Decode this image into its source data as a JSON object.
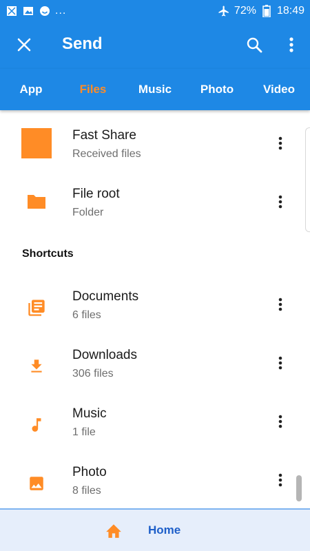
{
  "status_bar": {
    "battery_percent": "72%",
    "time": "18:49",
    "more_notifications": "...",
    "icons": [
      "gallery-notification-icon",
      "image-icon",
      "smiley-icon",
      "airplane-mode-icon",
      "battery-icon"
    ]
  },
  "app_bar": {
    "title": "Send",
    "icons": [
      "close-icon",
      "search-icon",
      "more-vert-icon"
    ],
    "background": "#1e88e5"
  },
  "tabs": [
    {
      "label": "App",
      "active": false
    },
    {
      "label": "Files",
      "active": true
    },
    {
      "label": "Music",
      "active": false
    },
    {
      "label": "Photo",
      "active": false
    },
    {
      "label": "Video",
      "active": false
    }
  ],
  "accent_color": "#ff8c26",
  "items": [
    {
      "title": "Fast Share",
      "subtitle": "Received files",
      "icon": "fast-share-square-icon"
    },
    {
      "title": "File root",
      "subtitle": "Folder",
      "icon": "folder-icon"
    }
  ],
  "shortcuts_header": "Shortcuts",
  "shortcuts": [
    {
      "title": "Documents",
      "subtitle": "6 files",
      "icon": "documents-icon"
    },
    {
      "title": "Downloads",
      "subtitle": "306 files",
      "icon": "download-icon"
    },
    {
      "title": "Music",
      "subtitle": "1 file",
      "icon": "music-note-icon"
    },
    {
      "title": "Photo",
      "subtitle": "8 files",
      "icon": "image-icon"
    }
  ],
  "bottom_bar": {
    "home_label": "Home",
    "icon": "home-icon"
  }
}
